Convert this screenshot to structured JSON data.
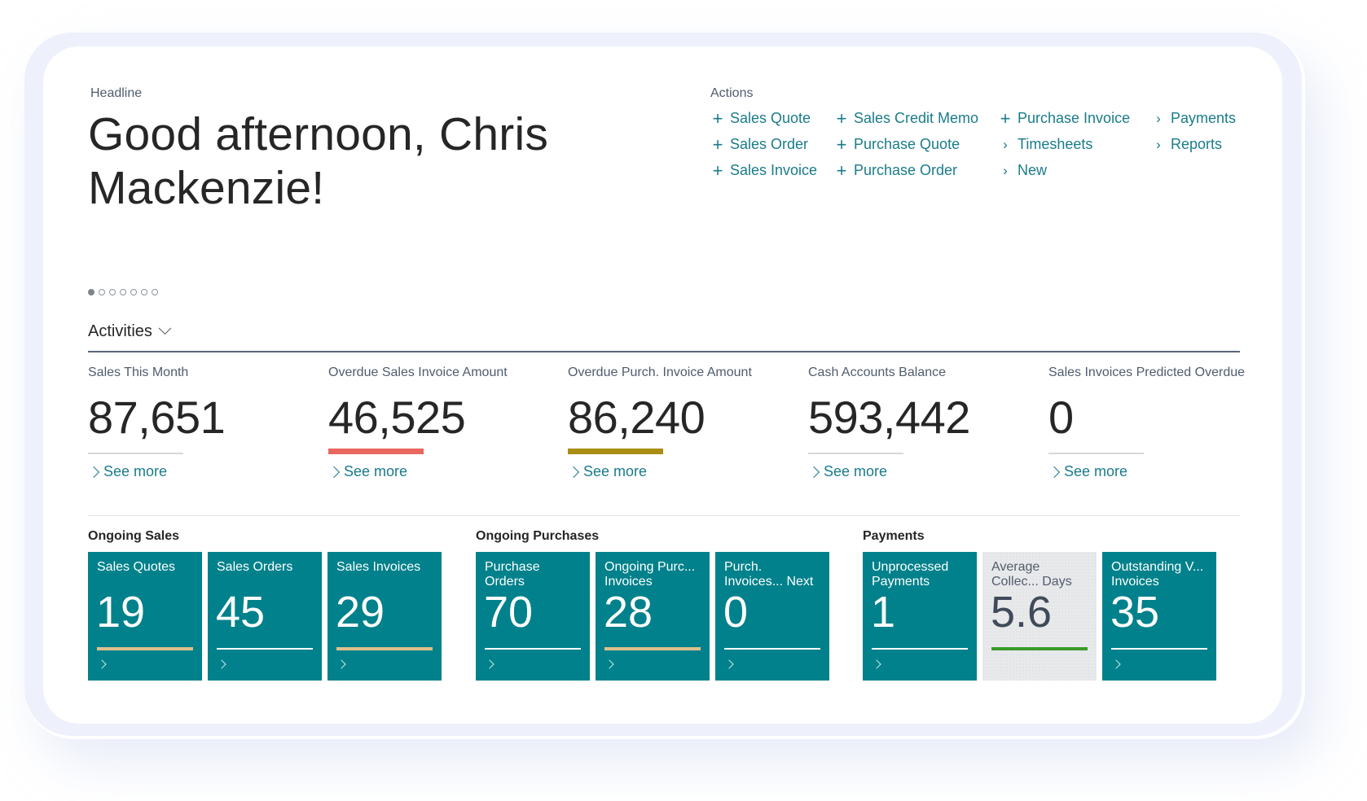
{
  "headline": {
    "label": "Headline",
    "greeting": "Good afternoon, Chris Mackenzie!",
    "carousel": {
      "total": 7,
      "active": 1
    }
  },
  "actions": {
    "label": "Actions",
    "items": [
      {
        "label": "Sales Quote",
        "icon": "plus-icon"
      },
      {
        "label": "Sales Order",
        "icon": "plus-icon"
      },
      {
        "label": "Sales Invoice",
        "icon": "plus-icon"
      },
      {
        "label": "Sales Credit Memo",
        "icon": "plus-icon"
      },
      {
        "label": "Purchase Quote",
        "icon": "plus-icon"
      },
      {
        "label": "Purchase Order",
        "icon": "plus-icon"
      },
      {
        "label": "Purchase Invoice",
        "icon": "plus-icon"
      },
      {
        "label": "Timesheets",
        "icon": "chevron-right-icon"
      },
      {
        "label": "New",
        "icon": "chevron-right-icon"
      },
      {
        "label": "Payments",
        "icon": "chevron-right-icon"
      },
      {
        "label": "Reports",
        "icon": "chevron-right-icon"
      }
    ]
  },
  "activities": {
    "title": "Activities",
    "see_more_label": "See more",
    "kpis": [
      {
        "label": "Sales This Month",
        "value": "87,651",
        "indicator_color": "#d8d8d8",
        "indicator_style": "neutral"
      },
      {
        "label": "Overdue Sales Invoice Amount",
        "value": "46,525",
        "indicator_color": "#e8675e",
        "indicator_style": "alert"
      },
      {
        "label": "Overdue Purch. Invoice Amount",
        "value": "86,240",
        "indicator_color": "#a88e12",
        "indicator_style": "warning"
      },
      {
        "label": "Cash Accounts Balance",
        "value": "593,442",
        "indicator_color": "#d8d8d8",
        "indicator_style": "neutral"
      },
      {
        "label": "Sales Invoices Predicted Overdue",
        "value": "0",
        "indicator_color": "#d8d8d8",
        "indicator_style": "neutral"
      }
    ]
  },
  "groups": [
    {
      "title": "Ongoing Sales",
      "tiles": [
        {
          "label": "Sales Quotes",
          "value": "19",
          "indicator_color": "#e0c08a",
          "style": "teal"
        },
        {
          "label": "Sales Orders",
          "value": "45",
          "indicator_color": "#ffffff",
          "style": "teal"
        },
        {
          "label": "Sales Invoices",
          "value": "29",
          "indicator_color": "#e0c08a",
          "style": "teal"
        }
      ]
    },
    {
      "title": "Ongoing Purchases",
      "tiles": [
        {
          "label": "Purchase Orders",
          "value": "70",
          "indicator_color": "#ffffff",
          "style": "teal"
        },
        {
          "label": "Ongoing Purc... Invoices",
          "value": "28",
          "indicator_color": "#e0c08a",
          "style": "teal"
        },
        {
          "label": "Purch. Invoices... Next Week",
          "value": "0",
          "indicator_color": "#ffffff",
          "style": "teal"
        }
      ]
    },
    {
      "title": "Payments",
      "tiles": [
        {
          "label": "Unprocessed Payments",
          "value": "1",
          "indicator_color": "#ffffff",
          "style": "teal"
        },
        {
          "label": "Average Collec... Days",
          "value": "5.6",
          "indicator_color": "#3a9a2a",
          "style": "grey"
        },
        {
          "label": "Outstanding V... Invoices",
          "value": "35",
          "indicator_color": "#ffffff",
          "style": "teal"
        }
      ]
    }
  ],
  "colors": {
    "accent": "#1a7c8a",
    "tile": "#00818b",
    "tile_neutral": "#e8e9eb"
  }
}
